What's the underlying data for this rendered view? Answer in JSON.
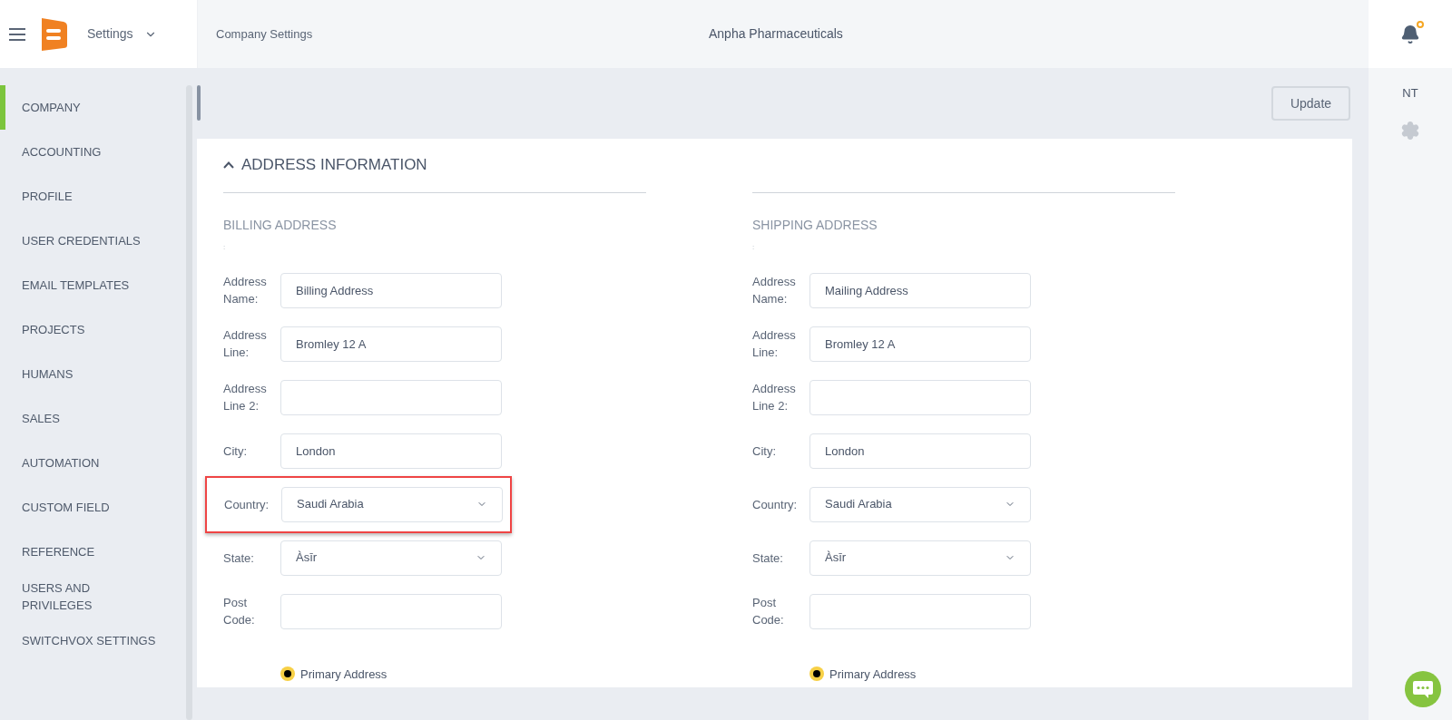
{
  "header": {
    "app_menu": "Settings",
    "breadcrumb": "Company Settings",
    "company": "Anpha Pharmaceuticals",
    "notification": true
  },
  "sidebar": {
    "items": [
      {
        "label": "COMPANY",
        "selected": true
      },
      {
        "label": "ACCOUNTING",
        "selected": false
      },
      {
        "label": "PROFILE",
        "selected": false
      },
      {
        "label": "USER CREDENTIALS",
        "selected": false
      },
      {
        "label": "EMAIL TEMPLATES",
        "selected": false
      },
      {
        "label": "PROJECTS",
        "selected": false
      },
      {
        "label": "HUMANS",
        "selected": false
      },
      {
        "label": "SALES",
        "selected": false
      },
      {
        "label": "AUTOMATION",
        "selected": false
      },
      {
        "label": "CUSTOM FIELD",
        "selected": false
      },
      {
        "label": "REFERENCE",
        "selected": false
      },
      {
        "label": "USERS AND PRIVILEGES",
        "selected": false
      },
      {
        "label": "SWITCHVOX SETTINGS",
        "selected": false
      }
    ]
  },
  "toolbar": {
    "update_button": "Update"
  },
  "right_rail": {
    "initials": "NT"
  },
  "section": {
    "title": "ADDRESS INFORMATION",
    "expanded": true,
    "columns": [
      {
        "heading": "BILLING ADDRESS",
        "note": ":",
        "fields": [
          {
            "kind": "text",
            "label": "Address Name:",
            "value": "Billing Address",
            "highlighted": false
          },
          {
            "kind": "text",
            "label": "Address Line:",
            "value": "Bromley 12 A",
            "highlighted": false
          },
          {
            "kind": "text",
            "label": "Address Line 2:",
            "highlighted": false
          },
          {
            "kind": "text",
            "label": "City:",
            "value": "London",
            "highlighted": false
          },
          {
            "kind": "select",
            "label": "Country:",
            "value": "Saudi Arabia",
            "highlighted": true
          },
          {
            "kind": "select",
            "label": "State:",
            "value": "Àsīr",
            "highlighted": false
          },
          {
            "kind": "text",
            "label": "Post Code:",
            "highlighted": false
          }
        ],
        "primary": {
          "label": "Primary Address",
          "selected": true
        }
      },
      {
        "heading": "SHIPPING ADDRESS",
        "note": ":",
        "fields": [
          {
            "kind": "text",
            "label": "Address Name:",
            "value": "Mailing Address",
            "highlighted": false
          },
          {
            "kind": "text",
            "label": "Address Line:",
            "value": "Bromley 12 A",
            "highlighted": false
          },
          {
            "kind": "text",
            "label": "Address Line 2:",
            "highlighted": false
          },
          {
            "kind": "text",
            "label": "City:",
            "value": "London",
            "highlighted": false
          },
          {
            "kind": "select",
            "label": "Country:",
            "value": "Saudi Arabia",
            "highlighted": false
          },
          {
            "kind": "select",
            "label": "State:",
            "value": "Àsīr",
            "highlighted": false
          },
          {
            "kind": "text",
            "label": "Post Code:",
            "highlighted": false
          }
        ],
        "primary": {
          "label": "Primary Address",
          "selected": true
        }
      }
    ]
  }
}
